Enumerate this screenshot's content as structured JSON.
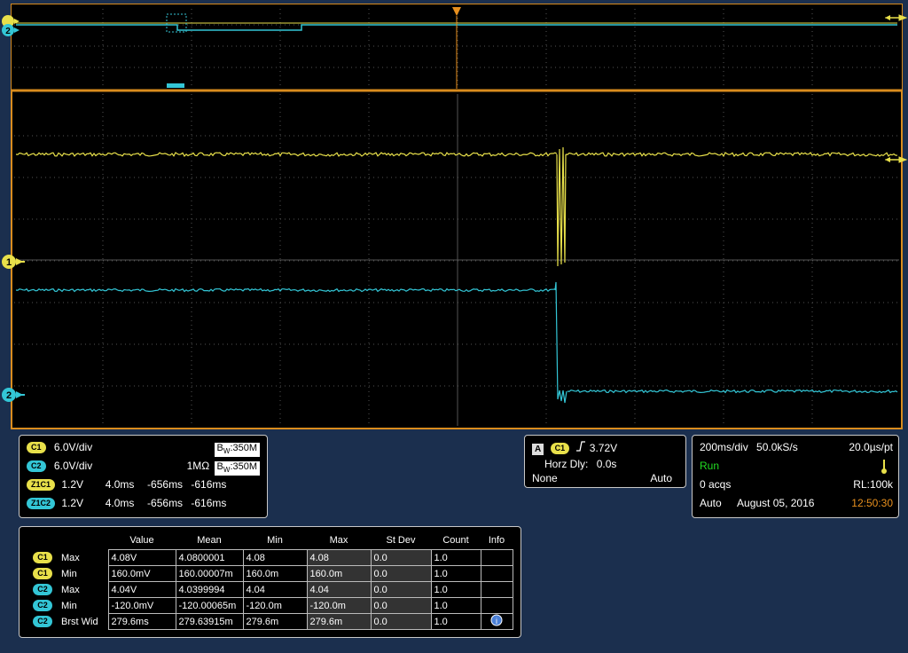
{
  "screen": {
    "background": "#1b2f4e",
    "frame_color": "#d98c1e",
    "ch1_color": "#e8e04a",
    "ch2_color": "#33c6d6",
    "trigger_marker_color": "#e8901e",
    "marker_labels": {
      "one": "1",
      "two": "2"
    }
  },
  "channels": [
    {
      "badge": "C1",
      "scale": "6.0V/div",
      "coupling": "",
      "bw_prefix": "B",
      "bw_sub": "W",
      "bw_value": ":350M"
    },
    {
      "badge": "C2",
      "scale": "6.0V/div",
      "coupling": "1MΩ",
      "bw_prefix": "B",
      "bw_sub": "W",
      "bw_value": ":350M"
    }
  ],
  "zoom": [
    {
      "badge": "Z1C1",
      "scale": "1.2V",
      "time": "4.0ms",
      "t1": "-656ms",
      "t2": "-616ms"
    },
    {
      "badge": "Z1C2",
      "scale": "1.2V",
      "time": "4.0ms",
      "t1": "-656ms",
      "t2": "-616ms"
    }
  ],
  "trigger": {
    "source_letter": "A",
    "source_badge": "C1",
    "slope_icon": "rising-edge-icon",
    "level": "3.72V",
    "horz_dly_label": "Horz Dly:",
    "horz_dly_value": "0.0s",
    "mode_left": "None",
    "mode_right": "Auto"
  },
  "acquisition": {
    "timebase": "200ms/div",
    "sample_rate": "50.0kS/s",
    "resolution": "20.0µs/pt",
    "state": "Run",
    "state_color": "#22dd22",
    "acqs": "0 acqs",
    "record_length": "RL:100k",
    "mode": "Auto",
    "date": "August 05, 2016",
    "time": "12:50:30",
    "time_color": "#e8901e"
  },
  "measurements": {
    "headers": [
      "Value",
      "Mean",
      "Min",
      "Max",
      "St Dev",
      "Count",
      "Info"
    ],
    "rows": [
      {
        "badge": "C1",
        "name": "Max",
        "value": "4.08V",
        "mean": "4.0800001",
        "min": "4.08",
        "max": "4.08",
        "stdev": "0.0",
        "count": "1.0"
      },
      {
        "badge": "C1",
        "name": "Min",
        "value": "160.0mV",
        "mean": "160.00007m",
        "min": "160.0m",
        "max": "160.0m",
        "stdev": "0.0",
        "count": "1.0"
      },
      {
        "badge": "C2",
        "name": "Max",
        "value": "4.04V",
        "mean": "4.0399994",
        "min": "4.04",
        "max": "4.04",
        "stdev": "0.0",
        "count": "1.0"
      },
      {
        "badge": "C2",
        "name": "Min",
        "value": "-120.0mV",
        "mean": "-120.00065m",
        "min": "-120.0m",
        "max": "-120.0m",
        "stdev": "0.0",
        "count": "1.0"
      },
      {
        "badge": "C2",
        "name": "Brst Wid",
        "value": "279.6ms",
        "mean": "279.63915m",
        "min": "279.6m",
        "max": "279.6m",
        "stdev": "0.0",
        "count": "1.0"
      }
    ],
    "info_icon": "info-icon"
  }
}
